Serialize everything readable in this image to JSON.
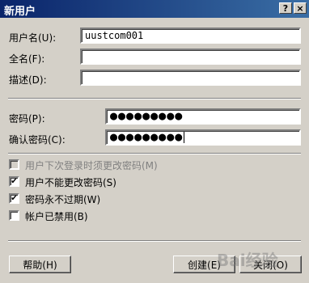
{
  "window": {
    "title": "新用户",
    "help_btn": "?",
    "close_btn": "×"
  },
  "form": {
    "username_label": "用户名(U):",
    "username_value": "uustcom001",
    "fullname_label": "全名(F):",
    "fullname_value": "",
    "description_label": "描述(D):",
    "description_value": "",
    "password_label": "密码(P):",
    "password_value": "●●●●●●●●●",
    "confirm_label": "确认密码(C):",
    "confirm_value": "●●●●●●●●●"
  },
  "options": [
    {
      "label": "用户下次登录时须更改密码(M)",
      "checked": false,
      "enabled": false
    },
    {
      "label": "用户不能更改密码(S)",
      "checked": true,
      "enabled": true
    },
    {
      "label": "密码永不过期(W)",
      "checked": true,
      "enabled": true
    },
    {
      "label": "帐户已禁用(B)",
      "checked": false,
      "enabled": true
    }
  ],
  "buttons": {
    "help": "帮助(H)",
    "create": "创建(E)",
    "close": "关闭(O)"
  },
  "watermark": "Bai经验"
}
